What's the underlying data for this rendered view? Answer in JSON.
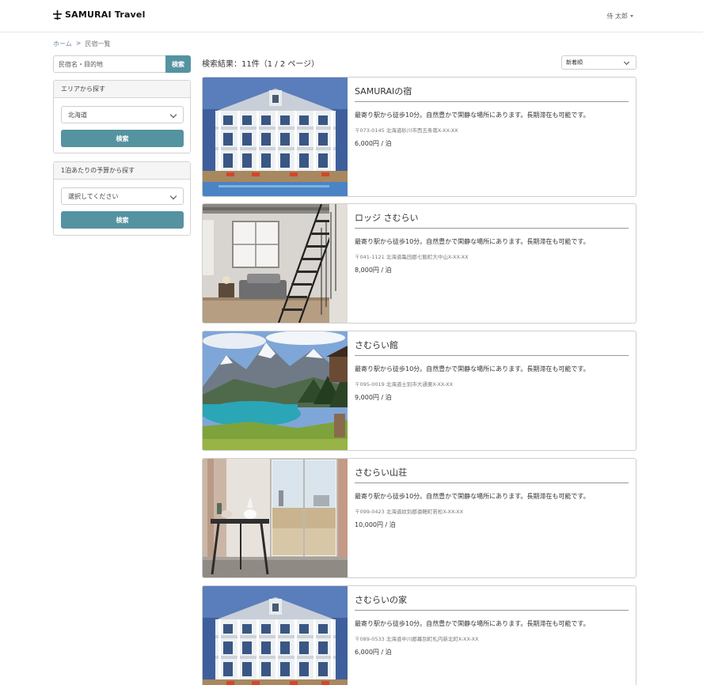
{
  "header": {
    "brand": "SAMURAI Travel",
    "user_name": "侍 太郎"
  },
  "breadcrumb": {
    "home": "ホーム",
    "separator": ">",
    "current": "民宿一覧"
  },
  "sidebar": {
    "search": {
      "placeholder": "民宿名・目的地",
      "button": "検索"
    },
    "area_panel": {
      "title": "エリアから探す",
      "selected": "北海道",
      "button": "検索"
    },
    "budget_panel": {
      "title": "1泊あたりの予算から探す",
      "selected": "選択してください",
      "button": "検索"
    }
  },
  "main": {
    "result_text": "検索結果：11件（1 / 2 ページ）",
    "sort_selected": "新着順",
    "listings": [
      {
        "name": "SAMURAIの宿",
        "description": "最寄り駅から徒歩10分。自然豊かで閑静な場所にあります。長期滞在も可能です。",
        "address": "〒073-0145 北海道砂川市西五条南X-XX-XX",
        "price": "6,000円 / 泊",
        "image": "house-exterior"
      },
      {
        "name": "ロッジ さむらい",
        "description": "最寄り駅から徒歩10分。自然豊かで閑静な場所にあります。長期滞在も可能です。",
        "address": "〒041-1121 北海道亀田郡七飯町大中山X-XX-XX",
        "price": "8,000円 / 泊",
        "image": "loft-interior"
      },
      {
        "name": "さむらい館",
        "description": "最寄り駅から徒歩10分。自然豊かで閑静な場所にあります。長期滞在も可能です。",
        "address": "〒095-0019 北海道士別市大通東X-XX-XX",
        "price": "9,000円 / 泊",
        "image": "mountain-lake"
      },
      {
        "name": "さむらい山荘",
        "description": "最寄り駅から徒歩10分。自然豊かで閑静な場所にあります。長期滞在も可能です。",
        "address": "〒099-0423 北海道紋別郡遠軽町若松X-XX-XX",
        "price": "10,000円 / 泊",
        "image": "room-window-view"
      },
      {
        "name": "さむらいの家",
        "description": "最寄り駅から徒歩10分。自然豊かで閑静な場所にあります。長期滞在も可能です。",
        "address": "〒089-0533 北海道中川郡幕別町札内新北町X-XX-XX",
        "price": "6,000円 / 泊",
        "image": "house-exterior"
      }
    ]
  }
}
